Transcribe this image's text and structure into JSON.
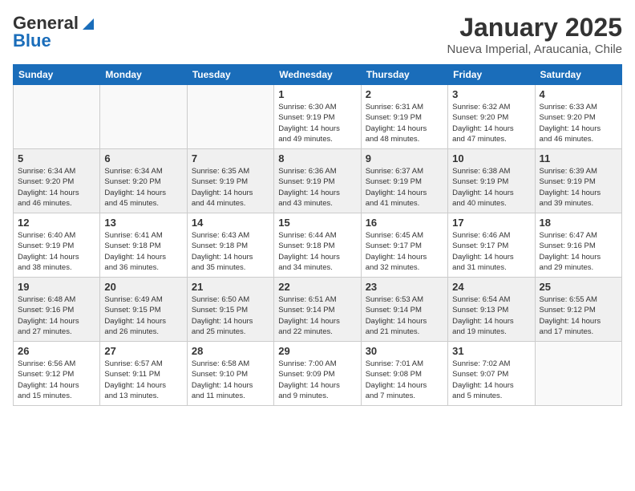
{
  "header": {
    "logo_general": "General",
    "logo_blue": "Blue",
    "month_year": "January 2025",
    "location": "Nueva Imperial, Araucania, Chile"
  },
  "calendar": {
    "days_of_week": [
      "Sunday",
      "Monday",
      "Tuesday",
      "Wednesday",
      "Thursday",
      "Friday",
      "Saturday"
    ],
    "weeks": [
      [
        {
          "day": "",
          "info": ""
        },
        {
          "day": "",
          "info": ""
        },
        {
          "day": "",
          "info": ""
        },
        {
          "day": "1",
          "info": "Sunrise: 6:30 AM\nSunset: 9:19 PM\nDaylight: 14 hours\nand 49 minutes."
        },
        {
          "day": "2",
          "info": "Sunrise: 6:31 AM\nSunset: 9:19 PM\nDaylight: 14 hours\nand 48 minutes."
        },
        {
          "day": "3",
          "info": "Sunrise: 6:32 AM\nSunset: 9:20 PM\nDaylight: 14 hours\nand 47 minutes."
        },
        {
          "day": "4",
          "info": "Sunrise: 6:33 AM\nSunset: 9:20 PM\nDaylight: 14 hours\nand 46 minutes."
        }
      ],
      [
        {
          "day": "5",
          "info": "Sunrise: 6:34 AM\nSunset: 9:20 PM\nDaylight: 14 hours\nand 46 minutes."
        },
        {
          "day": "6",
          "info": "Sunrise: 6:34 AM\nSunset: 9:20 PM\nDaylight: 14 hours\nand 45 minutes."
        },
        {
          "day": "7",
          "info": "Sunrise: 6:35 AM\nSunset: 9:19 PM\nDaylight: 14 hours\nand 44 minutes."
        },
        {
          "day": "8",
          "info": "Sunrise: 6:36 AM\nSunset: 9:19 PM\nDaylight: 14 hours\nand 43 minutes."
        },
        {
          "day": "9",
          "info": "Sunrise: 6:37 AM\nSunset: 9:19 PM\nDaylight: 14 hours\nand 41 minutes."
        },
        {
          "day": "10",
          "info": "Sunrise: 6:38 AM\nSunset: 9:19 PM\nDaylight: 14 hours\nand 40 minutes."
        },
        {
          "day": "11",
          "info": "Sunrise: 6:39 AM\nSunset: 9:19 PM\nDaylight: 14 hours\nand 39 minutes."
        }
      ],
      [
        {
          "day": "12",
          "info": "Sunrise: 6:40 AM\nSunset: 9:19 PM\nDaylight: 14 hours\nand 38 minutes."
        },
        {
          "day": "13",
          "info": "Sunrise: 6:41 AM\nSunset: 9:18 PM\nDaylight: 14 hours\nand 36 minutes."
        },
        {
          "day": "14",
          "info": "Sunrise: 6:43 AM\nSunset: 9:18 PM\nDaylight: 14 hours\nand 35 minutes."
        },
        {
          "day": "15",
          "info": "Sunrise: 6:44 AM\nSunset: 9:18 PM\nDaylight: 14 hours\nand 34 minutes."
        },
        {
          "day": "16",
          "info": "Sunrise: 6:45 AM\nSunset: 9:17 PM\nDaylight: 14 hours\nand 32 minutes."
        },
        {
          "day": "17",
          "info": "Sunrise: 6:46 AM\nSunset: 9:17 PM\nDaylight: 14 hours\nand 31 minutes."
        },
        {
          "day": "18",
          "info": "Sunrise: 6:47 AM\nSunset: 9:16 PM\nDaylight: 14 hours\nand 29 minutes."
        }
      ],
      [
        {
          "day": "19",
          "info": "Sunrise: 6:48 AM\nSunset: 9:16 PM\nDaylight: 14 hours\nand 27 minutes."
        },
        {
          "day": "20",
          "info": "Sunrise: 6:49 AM\nSunset: 9:15 PM\nDaylight: 14 hours\nand 26 minutes."
        },
        {
          "day": "21",
          "info": "Sunrise: 6:50 AM\nSunset: 9:15 PM\nDaylight: 14 hours\nand 25 minutes."
        },
        {
          "day": "22",
          "info": "Sunrise: 6:51 AM\nSunset: 9:14 PM\nDaylight: 14 hours\nand 22 minutes."
        },
        {
          "day": "23",
          "info": "Sunrise: 6:53 AM\nSunset: 9:14 PM\nDaylight: 14 hours\nand 21 minutes."
        },
        {
          "day": "24",
          "info": "Sunrise: 6:54 AM\nSunset: 9:13 PM\nDaylight: 14 hours\nand 19 minutes."
        },
        {
          "day": "25",
          "info": "Sunrise: 6:55 AM\nSunset: 9:12 PM\nDaylight: 14 hours\nand 17 minutes."
        }
      ],
      [
        {
          "day": "26",
          "info": "Sunrise: 6:56 AM\nSunset: 9:12 PM\nDaylight: 14 hours\nand 15 minutes."
        },
        {
          "day": "27",
          "info": "Sunrise: 6:57 AM\nSunset: 9:11 PM\nDaylight: 14 hours\nand 13 minutes."
        },
        {
          "day": "28",
          "info": "Sunrise: 6:58 AM\nSunset: 9:10 PM\nDaylight: 14 hours\nand 11 minutes."
        },
        {
          "day": "29",
          "info": "Sunrise: 7:00 AM\nSunset: 9:09 PM\nDaylight: 14 hours\nand 9 minutes."
        },
        {
          "day": "30",
          "info": "Sunrise: 7:01 AM\nSunset: 9:08 PM\nDaylight: 14 hours\nand 7 minutes."
        },
        {
          "day": "31",
          "info": "Sunrise: 7:02 AM\nSunset: 9:07 PM\nDaylight: 14 hours\nand 5 minutes."
        },
        {
          "day": "",
          "info": ""
        }
      ]
    ]
  }
}
